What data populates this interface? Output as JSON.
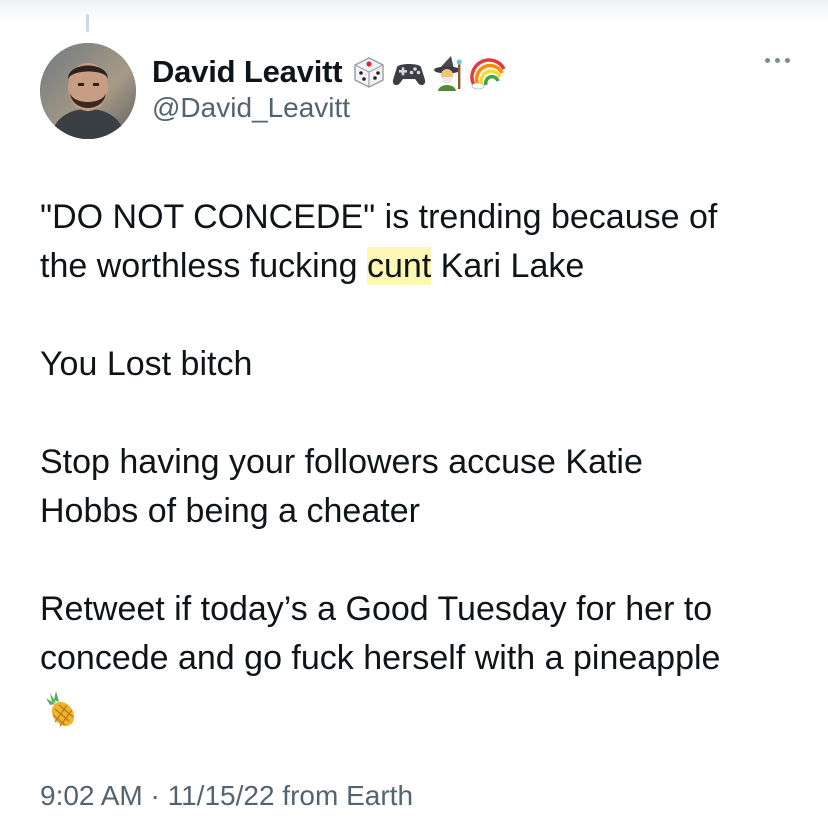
{
  "author": {
    "display_name": "David Leavitt",
    "handle": "@David_Leavitt",
    "name_emojis": [
      "dice-emoji",
      "game-controller-emoji",
      "mage-emoji",
      "rainbow-emoji"
    ]
  },
  "tweet": {
    "p1_a": "\"DO NOT CONCEDE\" is trending because of",
    "p1_b": "the worthless fucking ",
    "p1_highlight": "cunt",
    "p1_c": " Kari Lake",
    "p2": "You Lost bitch",
    "p3_a": "Stop having your followers accuse Katie",
    "p3_b": "Hobbs of being a cheater",
    "p4_a": "Retweet if today’s a Good Tuesday for her to",
    "p4_b": "concede and go fuck herself with a pineapple",
    "trailing_emoji": "pineapple-emoji"
  },
  "meta": {
    "timestamp": "9:02 AM · 11/15/22 from Earth"
  },
  "colors": {
    "text": "#0f1419",
    "secondary": "#536471",
    "highlight": "#fdf6b5"
  }
}
